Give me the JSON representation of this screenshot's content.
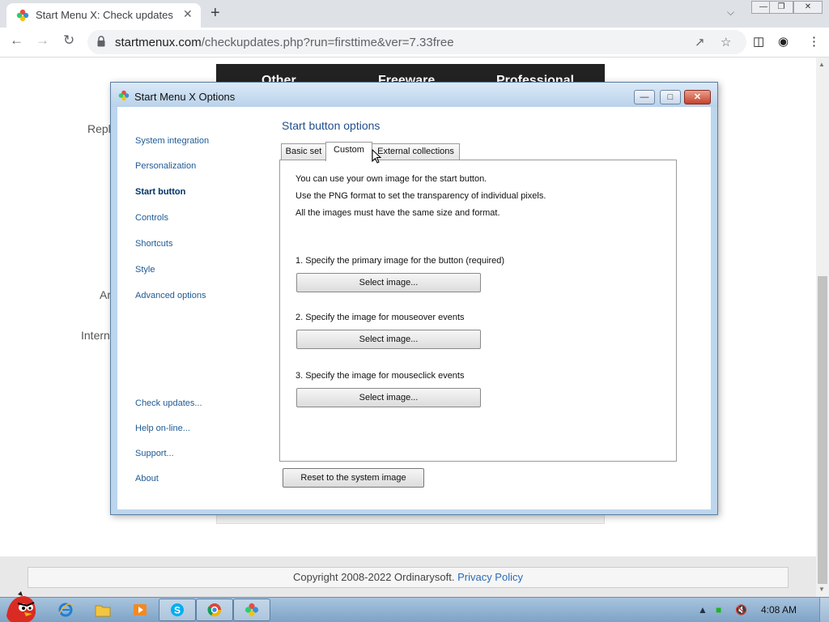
{
  "browser": {
    "tab_title": "Start Menu X: Check updates",
    "tab_close": "✕",
    "new_tab": "+",
    "url_domain": "startmenux.com",
    "url_path": "/checkupdates.php?run=firsttime&ver=7.33free"
  },
  "page": {
    "fragments": [
      "Repl",
      "Ar",
      "Intern"
    ],
    "banner": [
      "Other",
      "Freeware",
      "Professional"
    ],
    "footer_text": "Copyright 2008-2022 Ordinarysoft.",
    "footer_link": "Privacy Policy"
  },
  "dialog": {
    "title": "Start Menu X Options",
    "nav_items": [
      {
        "label": "System integration"
      },
      {
        "label": "Personalization"
      },
      {
        "label": "Start button",
        "active": true
      },
      {
        "label": "Controls"
      },
      {
        "label": "Shortcuts"
      },
      {
        "label": "Style"
      },
      {
        "label": "Advanced options"
      }
    ],
    "nav_bottom": [
      {
        "label": "Check updates..."
      },
      {
        "label": "Help on-line..."
      },
      {
        "label": "Support..."
      },
      {
        "label": "About"
      }
    ],
    "section_title": "Start button options",
    "tabs": [
      {
        "label": "Basic set"
      },
      {
        "label": "Custom",
        "selected": true
      },
      {
        "label": "External collections"
      }
    ],
    "intro_lines": [
      "You can use your own image for the start button.",
      "Use the PNG format to set the transparency of individual pixels.",
      "All the images must have the same size and format."
    ],
    "image_options": [
      {
        "label": "1. Specify the primary image for the button (required)",
        "button": "Select image..."
      },
      {
        "label": "2. Specify the image for mouseover events",
        "button": "Select image..."
      },
      {
        "label": "3. Specify the image for mouseclick events",
        "button": "Select image..."
      }
    ],
    "reset_button": "Reset to the system image"
  },
  "taskbar": {
    "clock": "4:08 AM",
    "apps": [
      "internet-explorer-icon",
      "folder-icon",
      "media-player-icon",
      "skype-icon",
      "chrome-icon",
      "start-menu-x-icon"
    ]
  },
  "colors": {
    "link_blue": "#1f5a94",
    "title_blue": "#1f4e8c",
    "dialog_frame": "#bcd6ee",
    "taskbar": "#8fb0d0"
  }
}
